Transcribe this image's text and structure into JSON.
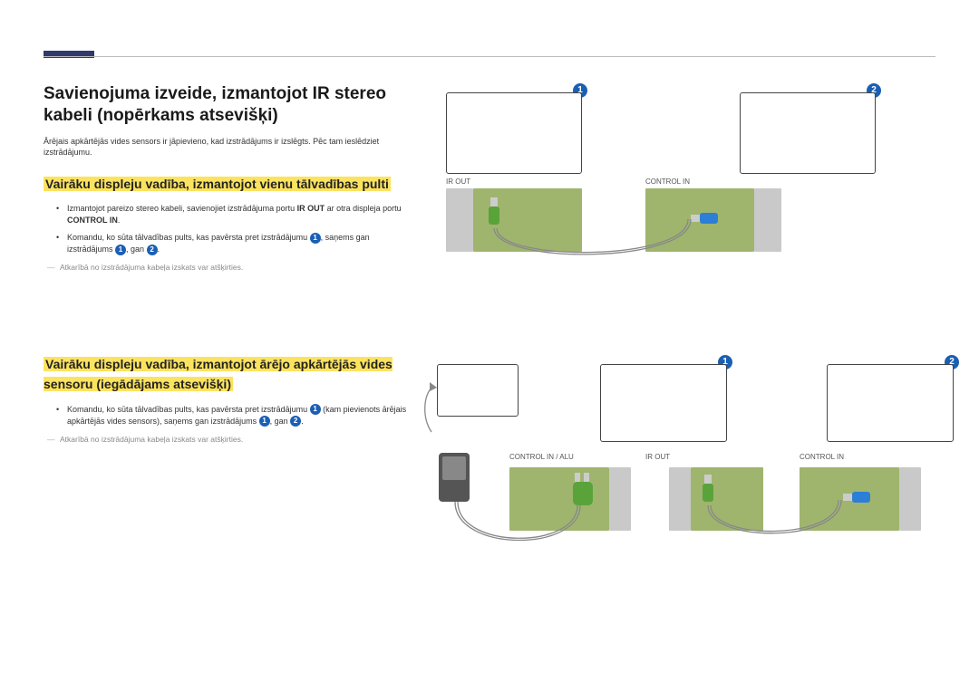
{
  "title": "Savienojuma izveide, izmantojot IR stereo kabeli (nopērkams atsevišķi)",
  "intro": "Ārējais apkārtējās vides sensors ir jāpievieno, kad izstrādājums ir izslēgts. Pēc tam ieslēdziet izstrādājumu.",
  "section1": {
    "heading": "Vairāku displeju vadība, izmantojot vienu tālvadības pulti",
    "bullet1_a": "Izmantojot pareizo stereo kabeli, savienojiet izstrādājuma portu ",
    "bullet1_b": "IR OUT",
    "bullet1_c": " ar otra displeja portu ",
    "bullet1_d": "CONTROL IN",
    "bullet1_e": ".",
    "bullet2_a": "Komandu, ko sūta tālvadības pults, kas pavērsta pret izstrādājumu ",
    "bullet2_b": ", saņems gan izstrādājums ",
    "bullet2_c": ", gan ",
    "bullet2_d": ".",
    "note": "Atkarībā no izstrādājuma kabeļa izskats var atšķirties."
  },
  "section2": {
    "heading": "Vairāku displeju vadība, izmantojot ārējo apkārtējās vides sensoru (iegādājams atsevišķi)",
    "bullet1_a": "Komandu, ko sūta tālvadības pults, kas pavērsta pret izstrādājumu ",
    "bullet1_b": " (kam pievienots ārējais apkārtējās vides sensors), saņems gan izstrādājums ",
    "bullet1_c": ", gan ",
    "bullet1_d": ".",
    "note": "Atkarībā no izstrādājuma kabeļa izskats var atšķirties."
  },
  "labels": {
    "ir_out": "IR OUT",
    "control_in": "CONTROL IN",
    "control_in_alu": "CONTROL IN / ALU",
    "b1": "1",
    "b2": "2"
  }
}
